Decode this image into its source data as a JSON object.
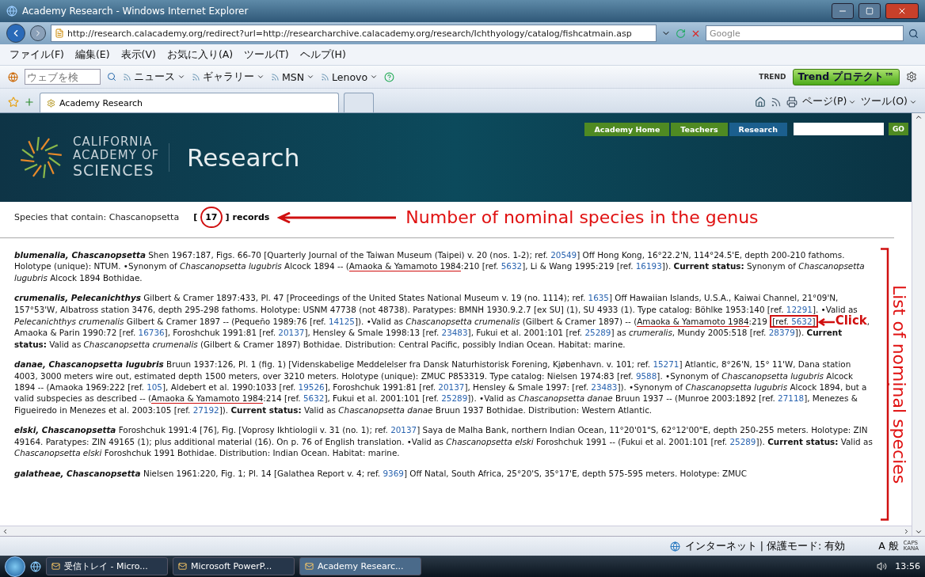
{
  "window": {
    "title": "Academy Research - Windows Internet Explorer"
  },
  "address_bar": {
    "url": "http://research.calacademy.org/redirect?url=http://researcharchive.calacademy.org/research/Ichthyology/catalog/fishcatmain.asp",
    "search_placeholder": "Google"
  },
  "menu": [
    "ファイル(F)",
    "編集(E)",
    "表示(V)",
    "お気に入り(A)",
    "ツール(T)",
    "ヘルプ(H)"
  ],
  "links_toolbar": {
    "search_placeholder": "ウェブを検",
    "items": [
      "ニュース",
      "ギャラリー",
      "MSN",
      "Lenovo"
    ],
    "trend_logo": "TREND",
    "trend_button": "Trend プロテクト™"
  },
  "tabs": [
    {
      "label": "Academy Research",
      "selected": true
    }
  ],
  "command_bar": [
    "ページ(P)",
    "ツール(O)"
  ],
  "site": {
    "logo": [
      "CALIFORNIA",
      "ACADEMY OF",
      "SCIENCES"
    ],
    "title": "Research",
    "go": "GO",
    "nav": [
      {
        "label": "Academy Home",
        "selected": false
      },
      {
        "label": "Teachers",
        "selected": false
      },
      {
        "label": "Research",
        "selected": true
      }
    ]
  },
  "summary": {
    "label": "Species that contain: Chascanopsetta",
    "open": "[",
    "count": "17",
    "close": "]",
    "unit": "records",
    "annotation": "Number of nominal species in the genus"
  },
  "entries": [
    {
      "parts": [
        {
          "kind": "name",
          "text": "blumenalia, Chascanopsetta"
        },
        {
          "kind": "text",
          "text": " Shen 1967:187, Figs. 66-70 [Quarterly Journal of the Taiwan Museum (Taipei) v. 20 (nos. 1-2); ref. "
        },
        {
          "kind": "link",
          "text": "20549"
        },
        {
          "kind": "text",
          "text": "] Off Hong Kong, 16°22.2'N, 114°24.5'E, depth 200-210 fathoms. Holotype (unique): NTUM. •Synonym of *Chascanopsetta lugubris* Alcock 1894 -- ("
        },
        {
          "kind": "underlined",
          "text": "Amaoka & Yamamoto 1984"
        },
        {
          "kind": "text",
          "text": ":210 [ref. "
        },
        {
          "kind": "link",
          "text": "5632"
        },
        {
          "kind": "text",
          "text": "], Li & Wang 1995:219 [ref. "
        },
        {
          "kind": "link",
          "text": "16193"
        },
        {
          "kind": "text",
          "text": "]). **Current status:** Synonym of *Chascanopsetta lugubris* Alcock 1894 Bothidae."
        }
      ]
    },
    {
      "parts": [
        {
          "kind": "name",
          "text": "crumenalis, Pelecanichthys"
        },
        {
          "kind": "text",
          "text": " Gilbert & Cramer 1897:433, Pl. 47 [Proceedings of the United States National Museum v. 19 (no. 1114); ref. "
        },
        {
          "kind": "link",
          "text": "1635"
        },
        {
          "kind": "text",
          "text": "] Off Hawaiian Islands, U.S.A., Kaiwai Channel, 21°09'N, 157°53'W, Albatross station 3476, depth 295-298 fathoms. Holotype: USNM 47738 (not 48738). Paratypes: BMNH 1930.9.2.7 [ex SU] (1), SU 4933 (1). Type catalog: Böhlke 1953:140 [ref. "
        },
        {
          "kind": "link",
          "text": "12291"
        },
        {
          "kind": "text",
          "text": "]. •Valid as *Pelecanichthys crumenalis* Gilbert & Cramer 1897 -- (Pequeño 1989:76 [ref. "
        },
        {
          "kind": "link",
          "text": "14125"
        },
        {
          "kind": "text",
          "text": "]). •Valid as *Chascanopsetta crumenalis* (Gilbert & Cramer 1897) -- ("
        },
        {
          "kind": "underlined",
          "text": "Amaoka & Yamamoto 1984"
        },
        {
          "kind": "text",
          "text": ":219 "
        },
        {
          "kind": "boxed",
          "parts": [
            {
              "kind": "text",
              "text": "[ref. "
            },
            {
              "kind": "link",
              "text": "5632"
            },
            {
              "kind": "text",
              "text": "]"
            }
          ]
        },
        {
          "kind": "callout",
          "text": "Click"
        },
        {
          "kind": "text",
          "text": ", Amaoka & Parin 1990:72 [ref. "
        },
        {
          "kind": "link",
          "text": "16736"
        },
        {
          "kind": "text",
          "text": "], Foroshchuk 1991:81 [ref. "
        },
        {
          "kind": "link",
          "text": "20137"
        },
        {
          "kind": "text",
          "text": "], Hensley & Smale 1998:13 [ref. "
        },
        {
          "kind": "link",
          "text": "23483"
        },
        {
          "kind": "text",
          "text": "], Fukui et al. 2001:101 [ref. "
        },
        {
          "kind": "link",
          "text": "25289"
        },
        {
          "kind": "text",
          "text": "] as *crumeralis*, Mundy 2005:518 [ref. "
        },
        {
          "kind": "link",
          "text": "28379"
        },
        {
          "kind": "text",
          "text": "]). **Current status:** Valid as *Chascanopsetta crumenalis* (Gilbert & Cramer 1897) Bothidae. Distribution: Central Pacific, possibly Indian Ocean. Habitat: marine."
        }
      ]
    },
    {
      "parts": [
        {
          "kind": "name",
          "text": "danae, Chascanopsetta lugubris"
        },
        {
          "kind": "text",
          "text": " Bruun 1937:126, Pl. 1 (fig. 1) [Videnskabelige Meddelelser fra Dansk Naturhistorisk Forening, Kjøbenhavn. v. 101; ref. "
        },
        {
          "kind": "link",
          "text": "15271"
        },
        {
          "kind": "text",
          "text": "] Atlantic, 8°26'N, 15° 11'W, Dana station 4003, 3000 meters wire out, estimated depth 1500 meters, over 3210 meters. Holotype (unique): ZMUC P853319. Type catalog: Nielsen 1974:83 [ref. "
        },
        {
          "kind": "link",
          "text": "9588"
        },
        {
          "kind": "text",
          "text": "]. •Synonym of *Chascanopsetta lugubris* Alcock 1894 -- (Amaoka 1969:222 [ref. "
        },
        {
          "kind": "link",
          "text": "105"
        },
        {
          "kind": "text",
          "text": "], Aldebert et al. 1990:1033 [ref. "
        },
        {
          "kind": "link",
          "text": "19526"
        },
        {
          "kind": "text",
          "text": "], Foroshchuk 1991:81 [ref. "
        },
        {
          "kind": "link",
          "text": "20137"
        },
        {
          "kind": "text",
          "text": "], Hensley & Smale 1997: [ref. "
        },
        {
          "kind": "link",
          "text": "23483"
        },
        {
          "kind": "text",
          "text": "]). •Synonym of *Chascanopsetta lugubris* Alcock 1894, but a valid subspecies as described -- ("
        },
        {
          "kind": "underlined",
          "text": "Amaoka & Yamamoto 1984"
        },
        {
          "kind": "text",
          "text": ":214 [ref. "
        },
        {
          "kind": "link",
          "text": "5632"
        },
        {
          "kind": "text",
          "text": "], Fukui et al. 2001:101 [ref. "
        },
        {
          "kind": "link",
          "text": "25289"
        },
        {
          "kind": "text",
          "text": "]). •Valid as *Chascanopsetta danae* Bruun 1937 -- (Munroe 2003:1892 [ref. "
        },
        {
          "kind": "link",
          "text": "27118"
        },
        {
          "kind": "text",
          "text": "], Menezes & Figueiredo in Menezes et al. 2003:105 [ref. "
        },
        {
          "kind": "link",
          "text": "27192"
        },
        {
          "kind": "text",
          "text": "]). **Current status:** Valid as *Chascanopsetta danae* Bruun 1937 Bothidae. Distribution: Western Atlantic."
        }
      ]
    },
    {
      "parts": [
        {
          "kind": "name",
          "text": "elski, Chascanopsetta"
        },
        {
          "kind": "text",
          "text": " Foroshchuk 1991:4 [76], Fig. [Voprosy Ikhtiologii v. 31 (no. 1); ref. "
        },
        {
          "kind": "link",
          "text": "20137"
        },
        {
          "kind": "text",
          "text": "] Saya de Malha Bank, northern Indian Ocean, 11°20'01\"S, 62°12'00\"E, depth 250-255 meters. Holotype: ZIN 49164. Paratypes: ZIN 49165 (1); plus additional material (16). On p. 76 of English translation. •Valid as *Chascanopsetta elski* Foroshchuk 1991 -- (Fukui et al. 2001:101 [ref. "
        },
        {
          "kind": "link",
          "text": "25289"
        },
        {
          "kind": "text",
          "text": "]). **Current status:** Valid as *Chascanopsetta elski* Foroshchuk 1991 Bothidae. Distribution: Indian Ocean. Habitat: marine."
        }
      ]
    },
    {
      "parts": [
        {
          "kind": "name",
          "text": "galatheae, Chascanopsetta"
        },
        {
          "kind": "text",
          "text": " Nielsen 1961:220, Fig. 1; Pl. 14 [Galathea Report v. 4; ref. "
        },
        {
          "kind": "link",
          "text": "9369"
        },
        {
          "kind": "text",
          "text": "] Off Natal, South Africa, 25°20'S, 35°17'E, depth 575-595 meters. Holotype: ZMUC"
        }
      ]
    }
  ],
  "side_annotation": "List of nominal species",
  "status_bar": {
    "zone": "インターネット | 保護モード: 有効",
    "ime": "A 般",
    "caps": "CAPS",
    "kana": "KANA"
  },
  "taskbar": {
    "tasks": [
      {
        "label": "受信トレイ - Micro...",
        "selected": false
      },
      {
        "label": "Microsoft PowerP...",
        "selected": false
      },
      {
        "label": "Academy Researc...",
        "selected": true
      }
    ],
    "clock": "13:56"
  }
}
